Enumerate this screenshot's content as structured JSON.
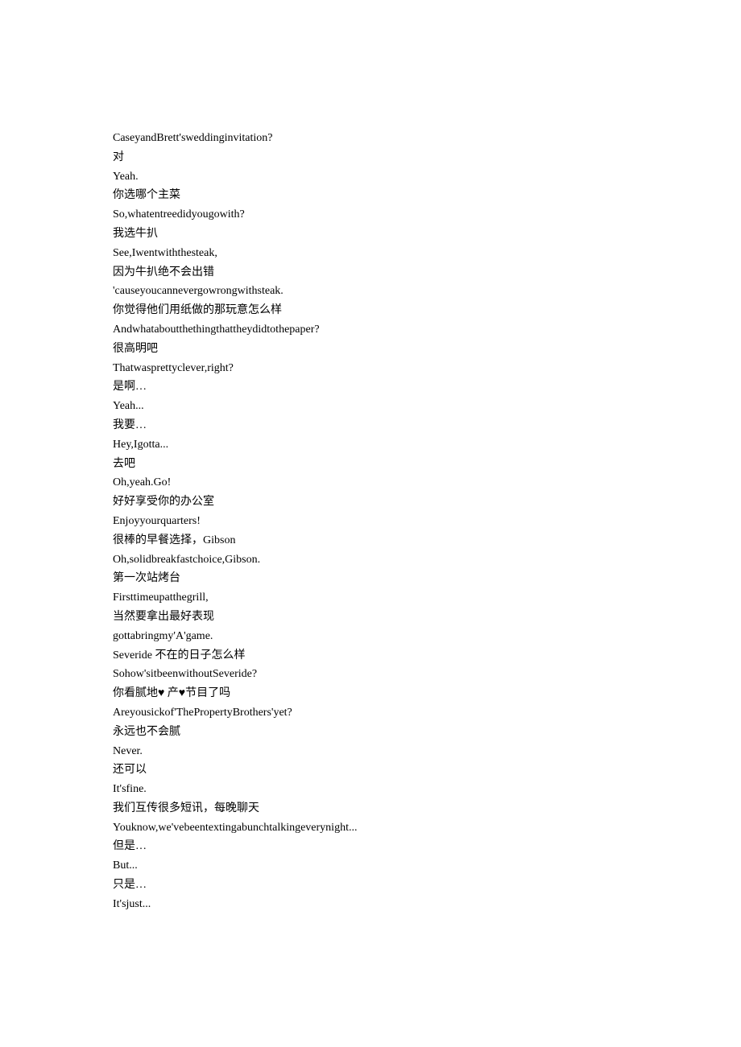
{
  "lines": [
    "CaseyandBrett'sweddinginvitation?",
    "对",
    "Yeah.",
    "你选哪个主菜",
    "So,whatentreedidyougowith?",
    "我选牛扒",
    "See,Iwentwiththesteak,",
    "因为牛扒绝不会出错",
    "'causeyoucannevergowrongwithsteak.",
    "你觉得他们用纸做的那玩意怎么样",
    "Andwhataboutthethingthattheydidtothepaper?",
    "很高明吧",
    "Thatwasprettyclever,right?",
    "是啊…",
    "Yeah...",
    "我要…",
    "Hey,Igotta...",
    "去吧",
    "Oh,yeah.Go!",
    "好好享受你的办公室",
    "Enjoyyourquarters!",
    "很棒的早餐选择，Gibson",
    "Oh,solidbreakfastchoice,Gibson.",
    "第一次站烤台",
    "Firsttimeupatthegrill,",
    "当然要拿出最好表现",
    "gottabringmy'A'game.",
    "Severide 不在的日子怎么样",
    "Sohow'sitbeenwithoutSeveride?",
    "你看腻地♥ 产♥节目了吗",
    "Areyousickof'ThePropertyBrothers'yet?",
    "永远也不会腻",
    "Never.",
    "还可以",
    "It'sfine.",
    "我们互传很多短讯，每晚聊天",
    "Youknow,we'vebeentextingabunchtalkingeverynight...",
    "但是…",
    "But...",
    "只是…",
    "It'sjust..."
  ]
}
